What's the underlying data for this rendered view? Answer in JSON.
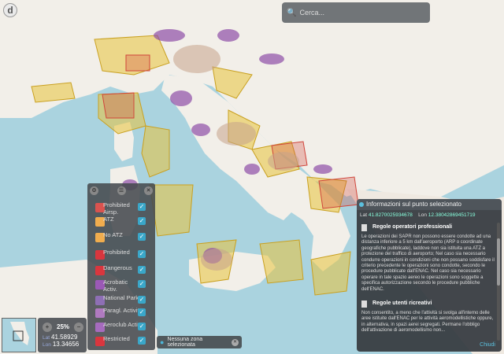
{
  "search": {
    "placeholder": "Cerca..."
  },
  "legend": {
    "items": [
      {
        "label": "Prohibited Airsp.",
        "color": "#d9534f"
      },
      {
        "label": "ATZ",
        "color": "#f0ad4e"
      },
      {
        "label": "No ATZ",
        "color": "#f0ad4e"
      },
      {
        "label": "Prohibited",
        "color": "#d9363e"
      },
      {
        "label": "Dangerous",
        "color": "#d9363e"
      },
      {
        "label": "Acrobatic Activ.",
        "color": "#9b59b6"
      },
      {
        "label": "National Park",
        "color": "#8e6fb5"
      },
      {
        "label": "Paragl. Activity",
        "color": "#b07ac0"
      },
      {
        "label": "Aeroclub Activ.",
        "color": "#a66bbe"
      },
      {
        "label": "Restricted",
        "color": "#d9363e"
      }
    ]
  },
  "zoom": {
    "percent": "25%",
    "in": "+",
    "out": "−"
  },
  "coords": {
    "lat_label": "Lat",
    "lat": "41.58929",
    "lon_label": "Lon",
    "lon": "13.34656"
  },
  "zone": {
    "text": "Nessuna zona selezionata"
  },
  "panel": {
    "title": "Informazioni sul punto selezionato",
    "lat_label": "Lat",
    "lat": "41.8270025934678",
    "lon_label": "Lon",
    "lon": "12.38042869451719",
    "sections": [
      {
        "heading": "Regole operatori professionali",
        "body": "Le operazioni dei SAPR non possono essere condotte ad una distanza inferiore a 5 km dall'aeroporto (ARP o coordinate geografiche pubblicate), laddove non sia istituita una ATZ a protezione del traffico di aeroporto; Nel caso sia necessario condurre operazioni in condizioni che non possano soddisfare il criterio precedente le operazioni sono condotte, secondo le procedure pubblicate dall'ENAC. Nel caso sia necessario operare in tale spazio aereo le operazioni sono soggette a specifica autorizzazione secondo le procedure pubbliche dell'ENAC."
      },
      {
        "heading": "Regole utenti ricreativi",
        "body": "Non consentito, a meno che l'attività si svolga all'interno delle aree istituite dall'ENAC per le attività aeromodellistiche oppure, in alternativa, in spazi aerei segregati. Permane l'obbligo dell'attivazione di aeromodellismo non...",
        "close": "Chiudi"
      }
    ]
  },
  "colors": {
    "sea": "#aad3df",
    "land": "#f2efe9",
    "zone_yellow": "#e8c23a",
    "zone_purple": "#8e4fa6",
    "zone_red": "#d0453b"
  }
}
